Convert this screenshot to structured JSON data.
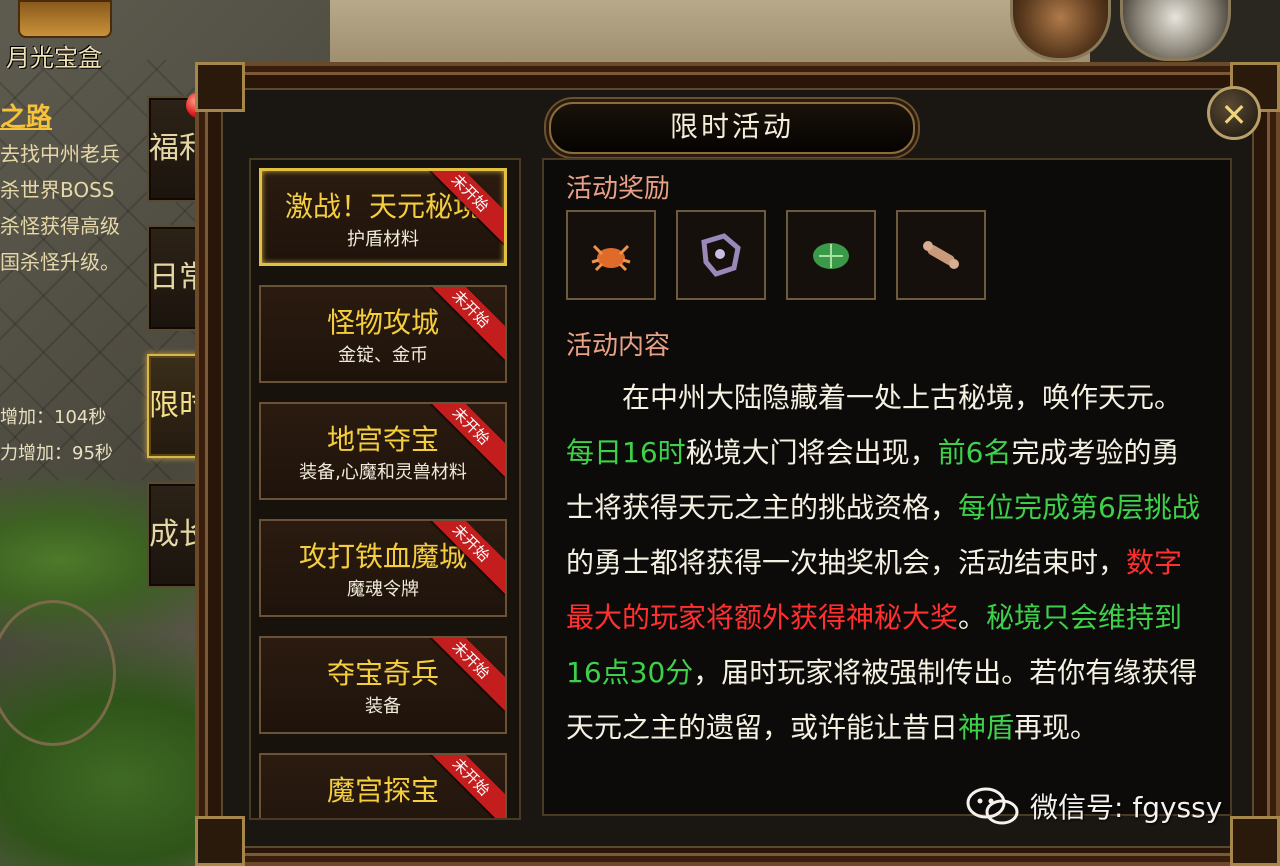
{
  "background": {
    "treasure_label": "月光宝盒",
    "quest": {
      "title": "之路",
      "lines": [
        "去找中州老兵",
        "杀世界BOSS",
        "杀怪获得高级",
        "国杀怪升级。"
      ],
      "bonus_lines": [
        "增加：104秒",
        "力增加：95秒"
      ]
    }
  },
  "side_tabs": [
    {
      "label": "福利",
      "active": false
    },
    {
      "label": "日常",
      "active": false
    },
    {
      "label": "限时",
      "active": true
    },
    {
      "label": "成长",
      "active": false
    }
  ],
  "window": {
    "title": "限时活动",
    "close_label": "✕"
  },
  "activities": [
    {
      "name": "激战！天元秘境",
      "sub": "护盾材料",
      "badge": "未开始",
      "active": true
    },
    {
      "name": "怪物攻城",
      "sub": "金锭、金币",
      "badge": "未开始",
      "active": false
    },
    {
      "name": "地宫夺宝",
      "sub": "装备,心魔和灵兽材料",
      "badge": "未开始",
      "active": false
    },
    {
      "name": "攻打铁血魔城",
      "sub": "魔魂令牌",
      "badge": "未开始",
      "active": false
    },
    {
      "name": "夺宝奇兵",
      "sub": "装备",
      "badge": "未开始",
      "active": false
    },
    {
      "name": "魔宫探宝",
      "sub": "",
      "badge": "未开始",
      "active": false
    }
  ],
  "detail": {
    "reward_heading": "活动奖励",
    "rewards": [
      {
        "icon": "orange-crab-icon",
        "color": "#e06a2a"
      },
      {
        "icon": "purple-crystal-icon",
        "color": "#9a88b8"
      },
      {
        "icon": "green-turtle-shell-icon",
        "color": "#3a9a4a"
      },
      {
        "icon": "bone-icon",
        "color": "#c99a7a"
      }
    ],
    "content_heading": "活动内容",
    "segments": [
      {
        "text": "　　在中州大陆隐藏着一处上古秘境，唤作天元。",
        "style": "normal"
      },
      {
        "text": "每日16时",
        "style": "green"
      },
      {
        "text": "秘境大门将会出现，",
        "style": "normal"
      },
      {
        "text": "前6名",
        "style": "green"
      },
      {
        "text": "完成考验的勇士将获得天元之主的挑战资格，",
        "style": "normal"
      },
      {
        "text": "每位完成第6层挑战",
        "style": "green"
      },
      {
        "text": "的勇士都将获得一次抽奖机会，活动结束时，",
        "style": "normal"
      },
      {
        "text": "数字最大的玩家将额外获得神秘大奖",
        "style": "red"
      },
      {
        "text": "。",
        "style": "normal"
      },
      {
        "text": "秘境只会维持到16点30分",
        "style": "green"
      },
      {
        "text": "，届时玩家将被强制传出。若你有缘获得天元之主的遗留，或许能让昔日",
        "style": "normal"
      },
      {
        "text": "神盾",
        "style": "green"
      },
      {
        "text": "再现。",
        "style": "normal"
      }
    ]
  },
  "watermark": "微信号: fgyssy"
}
